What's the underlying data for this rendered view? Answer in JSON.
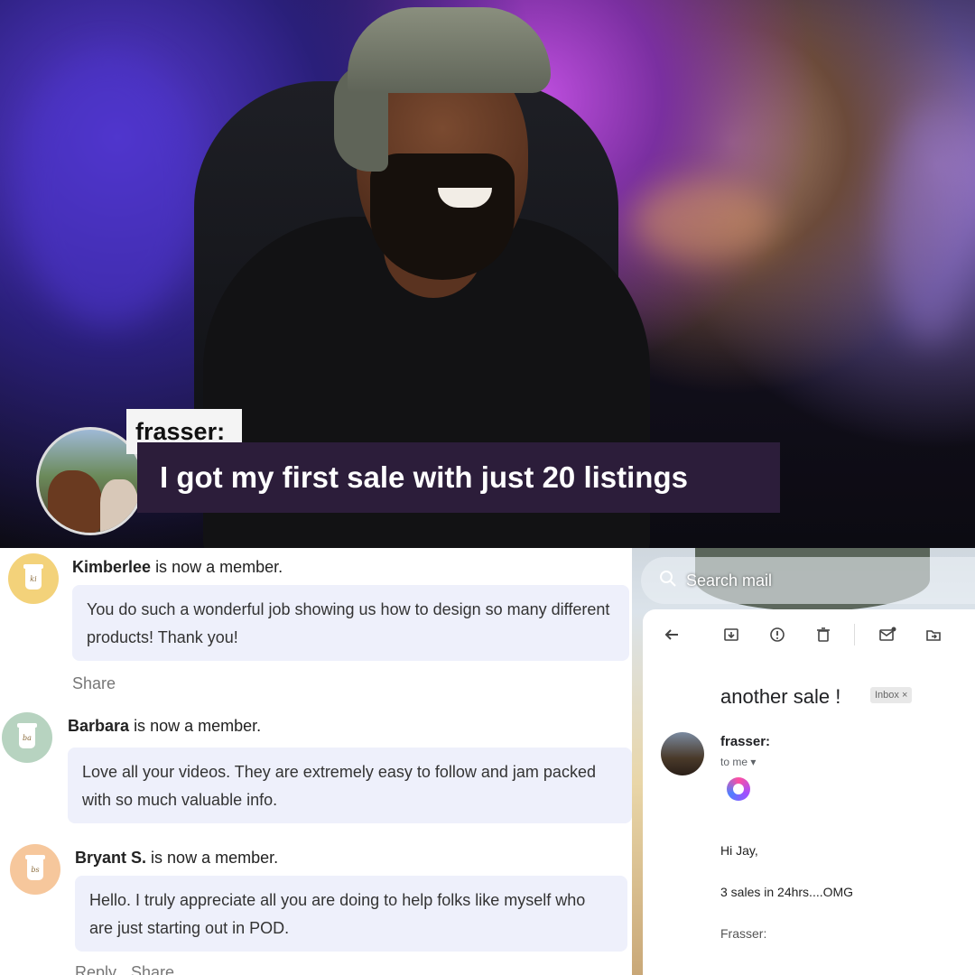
{
  "caption": {
    "username": "frasser:",
    "message": "I got my first sale with just 20 listings"
  },
  "comments": [
    {
      "name": "Kimberlee",
      "status": "is now a member.",
      "text": "You do such a wonderful job showing us how to design so many different products! Thank you!",
      "avatar_initials": "ki",
      "avatar_color": "#f3d27a",
      "actions": [
        "Share"
      ]
    },
    {
      "name": "Barbara",
      "status": "is now a member.",
      "text": "Love all your videos. They are extremely easy to follow and jam packed with so much valuable info.",
      "avatar_initials": "ba",
      "avatar_color": "#b7d3c0"
    },
    {
      "name": "Bryant S.",
      "status": "is now a member.",
      "text": "Hello. I truly appreciate all you are doing to help folks like myself who are just starting out in POD.",
      "avatar_initials": "bs",
      "avatar_color": "#f6c79c",
      "actions": [
        "Reply",
        "Share"
      ]
    }
  ],
  "mail": {
    "search_placeholder": "Search mail",
    "subject": "another sale !",
    "label": "Inbox ×",
    "sender": "frasser:",
    "recipient": "to me ▾",
    "body": [
      "Hi Jay,",
      "3 sales in 24hrs....OMG",
      "Frasser:"
    ],
    "toolbar_icons": [
      "back-arrow-icon",
      "archive-icon",
      "report-spam-icon",
      "delete-icon",
      "mark-unread-icon",
      "move-to-icon"
    ]
  }
}
